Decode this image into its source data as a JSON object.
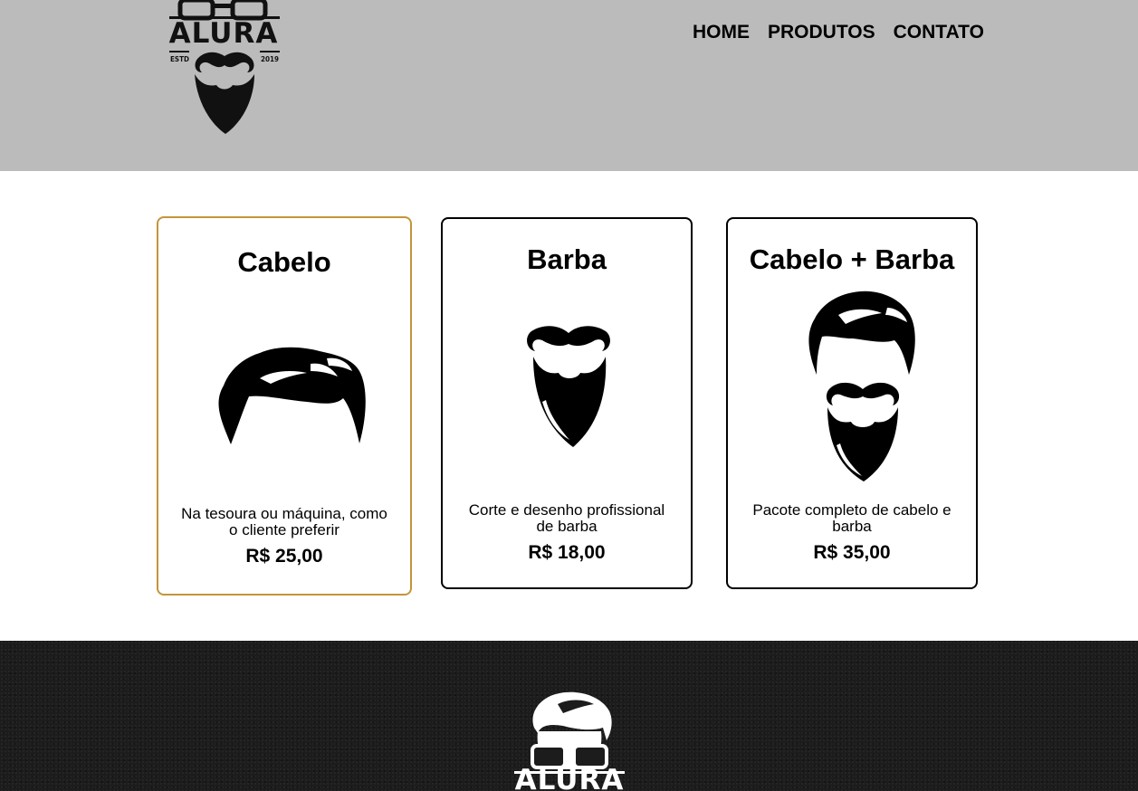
{
  "header": {
    "logo": {
      "wordmark": "ALURA",
      "estd": "ESTD",
      "year": "2019"
    },
    "nav": [
      {
        "label": "HOME"
      },
      {
        "label": "PRODUTOS"
      },
      {
        "label": "CONTATO"
      }
    ]
  },
  "products": [
    {
      "title": "Cabelo",
      "icon": "hair-icon",
      "description": "Na tesoura ou máquina, como o cliente preferir",
      "price": "R$ 25,00"
    },
    {
      "title": "Barba",
      "icon": "beard-icon",
      "description": "Corte e desenho profissional de barba",
      "price": "R$ 18,00"
    },
    {
      "title": "Cabelo + Barba",
      "icon": "hair-and-beard-icon",
      "description": "Pacote completo de cabelo e barba",
      "price": "R$ 35,00"
    }
  ],
  "footer": {
    "logo": {
      "wordmark": "ALURA"
    }
  },
  "colors": {
    "header_bg": "#bbbbbb",
    "active_border": "#c4953a",
    "footer_bg": "#1c1c1c"
  }
}
